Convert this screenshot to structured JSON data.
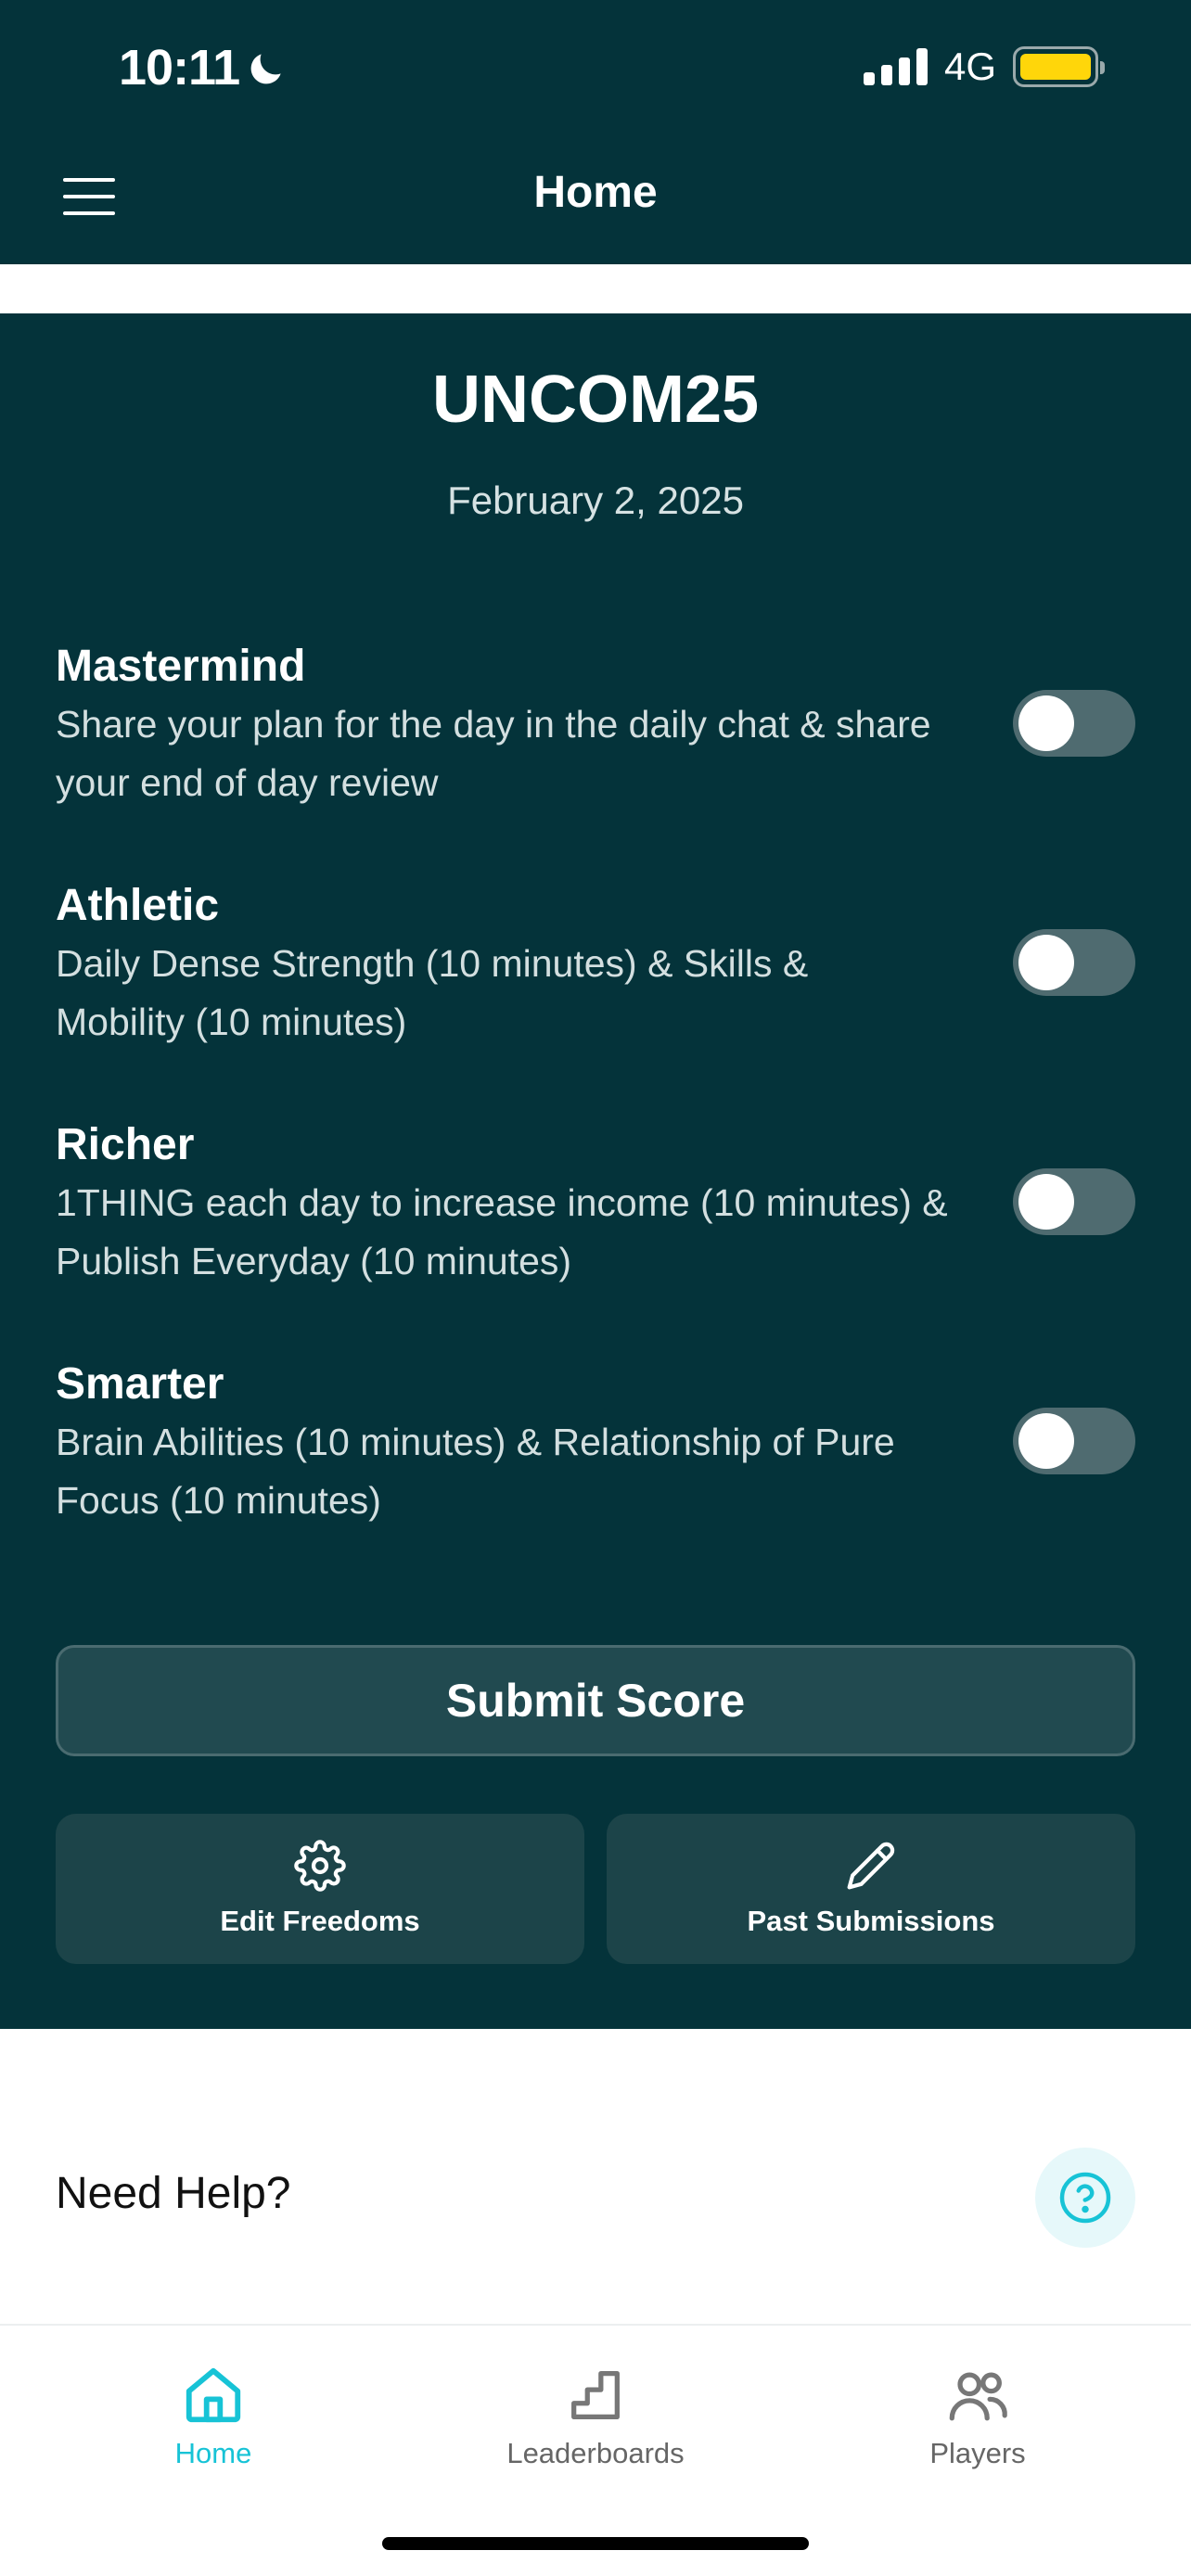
{
  "status_bar": {
    "time": "10:11",
    "network": "4G",
    "moon_icon": "moon-icon",
    "battery_color": "#ffd60a"
  },
  "header": {
    "title": "Home",
    "menu_icon": "hamburger-menu-icon",
    "background": "#04333a"
  },
  "challenge": {
    "name": "UNCOM25",
    "date": "February 2, 2025"
  },
  "habits": [
    {
      "name": "Mastermind",
      "description": "Share your plan for the day in the daily chat & share your end of day review",
      "enabled": false
    },
    {
      "name": "Athletic",
      "description": "Daily Dense Strength (10 minutes) & Skills & Mobility (10 minutes)",
      "enabled": false
    },
    {
      "name": "Richer",
      "description": "1THING each day to increase income (10 minutes) & Publish Everyday (10 minutes)",
      "enabled": false
    },
    {
      "name": "Smarter",
      "description": "Brain Abilities (10 minutes) & Relationship of Pure Focus (10 minutes)",
      "enabled": false
    }
  ],
  "actions": {
    "submit_label": "Submit Score",
    "edit_freedoms_label": "Edit Freedoms",
    "edit_freedoms_icon": "gear-icon",
    "past_submissions_label": "Past Submissions",
    "past_submissions_icon": "pencil-icon"
  },
  "help": {
    "label": "Need Help?",
    "icon": "question-circle-icon",
    "accent": "#17c3d6"
  },
  "tabs": [
    {
      "label": "Home",
      "icon": "home-icon",
      "active": true
    },
    {
      "label": "Leaderboards",
      "icon": "leaderboard-stairs-icon",
      "active": false
    },
    {
      "label": "Players",
      "icon": "players-icon",
      "active": false
    }
  ]
}
